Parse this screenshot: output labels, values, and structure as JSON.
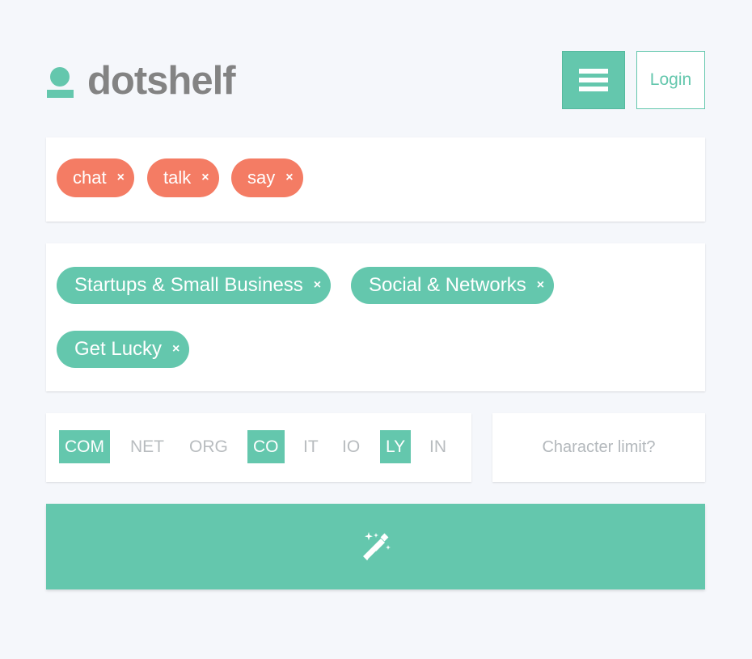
{
  "brand": {
    "name": "dotshelf",
    "logo_icon": "person-icon",
    "accent": "#64c7ad",
    "tag_color": "#f47c64"
  },
  "header": {
    "menu_icon": "hamburger-icon",
    "login_label": "Login"
  },
  "keywords": [
    {
      "label": "chat",
      "remove": "×"
    },
    {
      "label": "talk",
      "remove": "×"
    },
    {
      "label": "say",
      "remove": "×"
    }
  ],
  "categories": [
    {
      "label": "Startups & Small Business",
      "remove": "×"
    },
    {
      "label": "Social & Networks",
      "remove": "×"
    },
    {
      "label": "Get Lucky",
      "remove": "×"
    }
  ],
  "tlds": [
    {
      "label": "COM",
      "selected": true
    },
    {
      "label": "NET",
      "selected": false
    },
    {
      "label": "ORG",
      "selected": false
    },
    {
      "label": "CO",
      "selected": true
    },
    {
      "label": "IT",
      "selected": false
    },
    {
      "label": "IO",
      "selected": false
    },
    {
      "label": "LY",
      "selected": true
    },
    {
      "label": "IN",
      "selected": false
    }
  ],
  "char_limit": {
    "placeholder": "Character limit?",
    "value": ""
  },
  "generate": {
    "icon": "magic-wand-icon"
  }
}
